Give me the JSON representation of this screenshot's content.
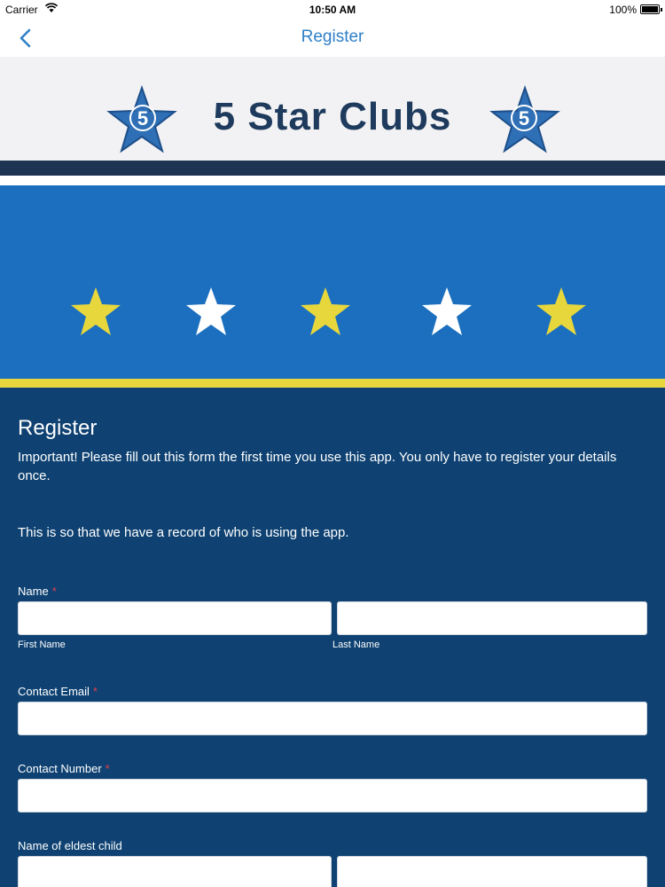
{
  "status_bar": {
    "carrier": "Carrier",
    "time": "10:50 AM",
    "battery": "100%"
  },
  "nav": {
    "title": "Register",
    "back_icon": "chevron-left-icon"
  },
  "banner": {
    "brand": "5 Star Clubs",
    "logo_digit": "5",
    "logo_icon": "star-logo-icon"
  },
  "colors": {
    "nav_title": "#2f80c8",
    "brand_text": "#1e3a5c",
    "blue_band": "#1b6fbe",
    "yellow": "#e7d73d",
    "form_bg": "#0f4272",
    "required": "#e0404a"
  },
  "rating_stars": [
    "yellow",
    "white",
    "yellow",
    "white",
    "yellow"
  ],
  "form": {
    "title": "Register",
    "intro": "Important! Please fill out this form the first time you use this app. You only have to register your details once.",
    "note": "This is so that we have a record of who is using the app.",
    "name": {
      "label": "Name",
      "required_mark": "*",
      "first_sub": "First Name",
      "last_sub": "Last Name",
      "first_value": "",
      "last_value": ""
    },
    "email": {
      "label": "Contact Email",
      "required_mark": "*",
      "value": ""
    },
    "phone": {
      "label": "Contact Number",
      "required_mark": "*",
      "value": ""
    },
    "child": {
      "label": "Name of eldest child",
      "first_value": "",
      "last_value": ""
    }
  }
}
